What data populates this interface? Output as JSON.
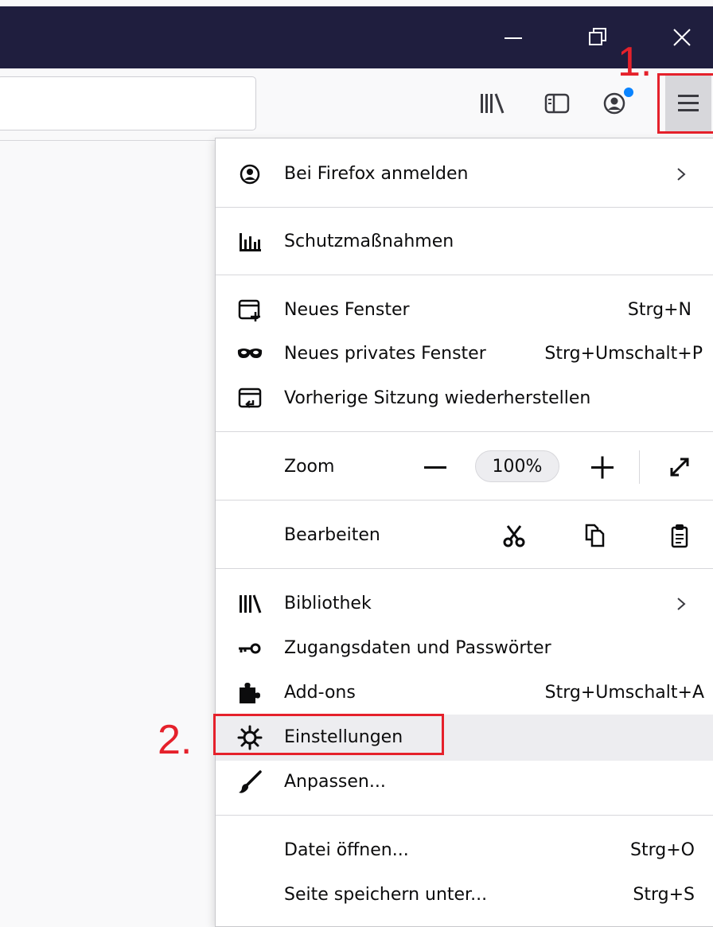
{
  "annotations": {
    "step1": "1.",
    "step2": "2."
  },
  "toolbar": {
    "url_value": "",
    "icons": [
      "library-icon",
      "sidebar-icon",
      "account-icon",
      "hamburger-menu-icon"
    ]
  },
  "colors": {
    "titlebar": "#1f1e3e",
    "annotation_red": "#e5212b",
    "badge_blue": "#0a84ff",
    "highlight": "#ededf0"
  },
  "menu": {
    "sign_in": "Bei Firefox anmelden",
    "protections": "Schutzmaßnahmen",
    "new_window": {
      "label": "Neues Fenster",
      "shortcut": "Strg+N"
    },
    "private_window": {
      "label": "Neues privates Fenster",
      "shortcut": "Strg+Umschalt+P"
    },
    "restore_session": "Vorherige Sitzung wiederherstellen",
    "zoom": {
      "label": "Zoom",
      "value": "100%",
      "minus": "−",
      "plus": "+"
    },
    "edit": {
      "label": "Bearbeiten"
    },
    "library": "Bibliothek",
    "logins": "Zugangsdaten und Passwörter",
    "addons": {
      "label": "Add-ons",
      "shortcut": "Strg+Umschalt+A"
    },
    "settings": "Einstellungen",
    "customize": "Anpassen...",
    "open_file": {
      "label": "Datei öffnen...",
      "shortcut": "Strg+O"
    },
    "save_page": {
      "label": "Seite speichern unter...",
      "shortcut": "Strg+S"
    }
  }
}
